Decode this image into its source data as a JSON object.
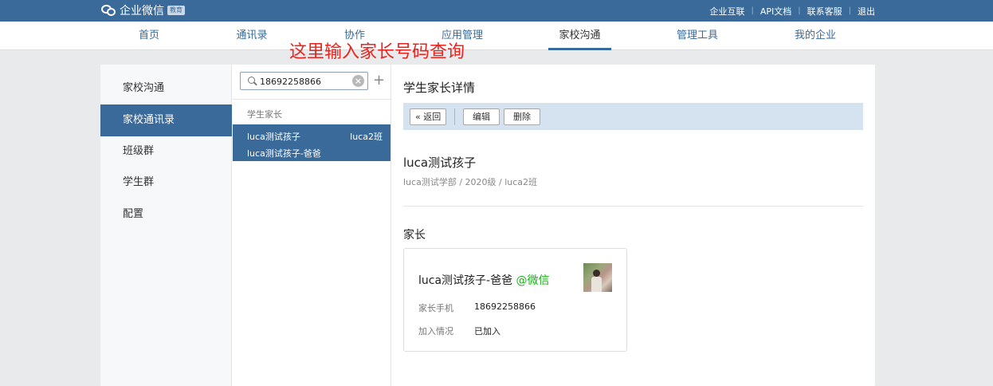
{
  "app": {
    "logo_text": "企业微信",
    "edition_tag": "教育",
    "top_links": [
      "企业互联",
      "API文档",
      "联系客服",
      "退出"
    ]
  },
  "nav": {
    "items": [
      "首页",
      "通讯录",
      "协作",
      "应用管理",
      "家校沟通",
      "管理工具",
      "我的企业"
    ],
    "active": "家校沟通"
  },
  "annotation": "这里输入家长号码查询",
  "sidebar": {
    "items": [
      "家校沟通",
      "家校通讯录",
      "班级群",
      "学生群",
      "配置"
    ],
    "active": "家校通讯录"
  },
  "search": {
    "value": "18692258866",
    "add_label": "+"
  },
  "results": {
    "group_label": "学生家长",
    "items": [
      {
        "student": "luca测试孩子",
        "class": "luca2班",
        "parent": "luca测试孩子-爸爸"
      }
    ]
  },
  "detail": {
    "title": "学生家长详情",
    "toolbar": {
      "back_label": "返回",
      "edit_label": "编辑",
      "delete_label": "删除"
    },
    "child_name": "luca测试孩子",
    "child_path": "luca测试学部 / 2020级 / luca2班",
    "parents_label": "家长",
    "parent_card": {
      "name": "luca测试孩子-爸爸",
      "wechat_tag": "@微信",
      "phone_label": "家长手机",
      "phone": "18692258866",
      "status_label": "加入情况",
      "status": "已加入"
    }
  },
  "colors": {
    "brand": "#3a6a9a",
    "toolbar_bg": "#d5e3f1",
    "wechat_green": "#1aad19",
    "annotation_red": "#e8241e"
  },
  "icons": [
    "chat-bubbles-logo-icon",
    "search-icon",
    "clear-icon",
    "plus-icon",
    "double-chevron-left-icon",
    "avatar-photo"
  ]
}
